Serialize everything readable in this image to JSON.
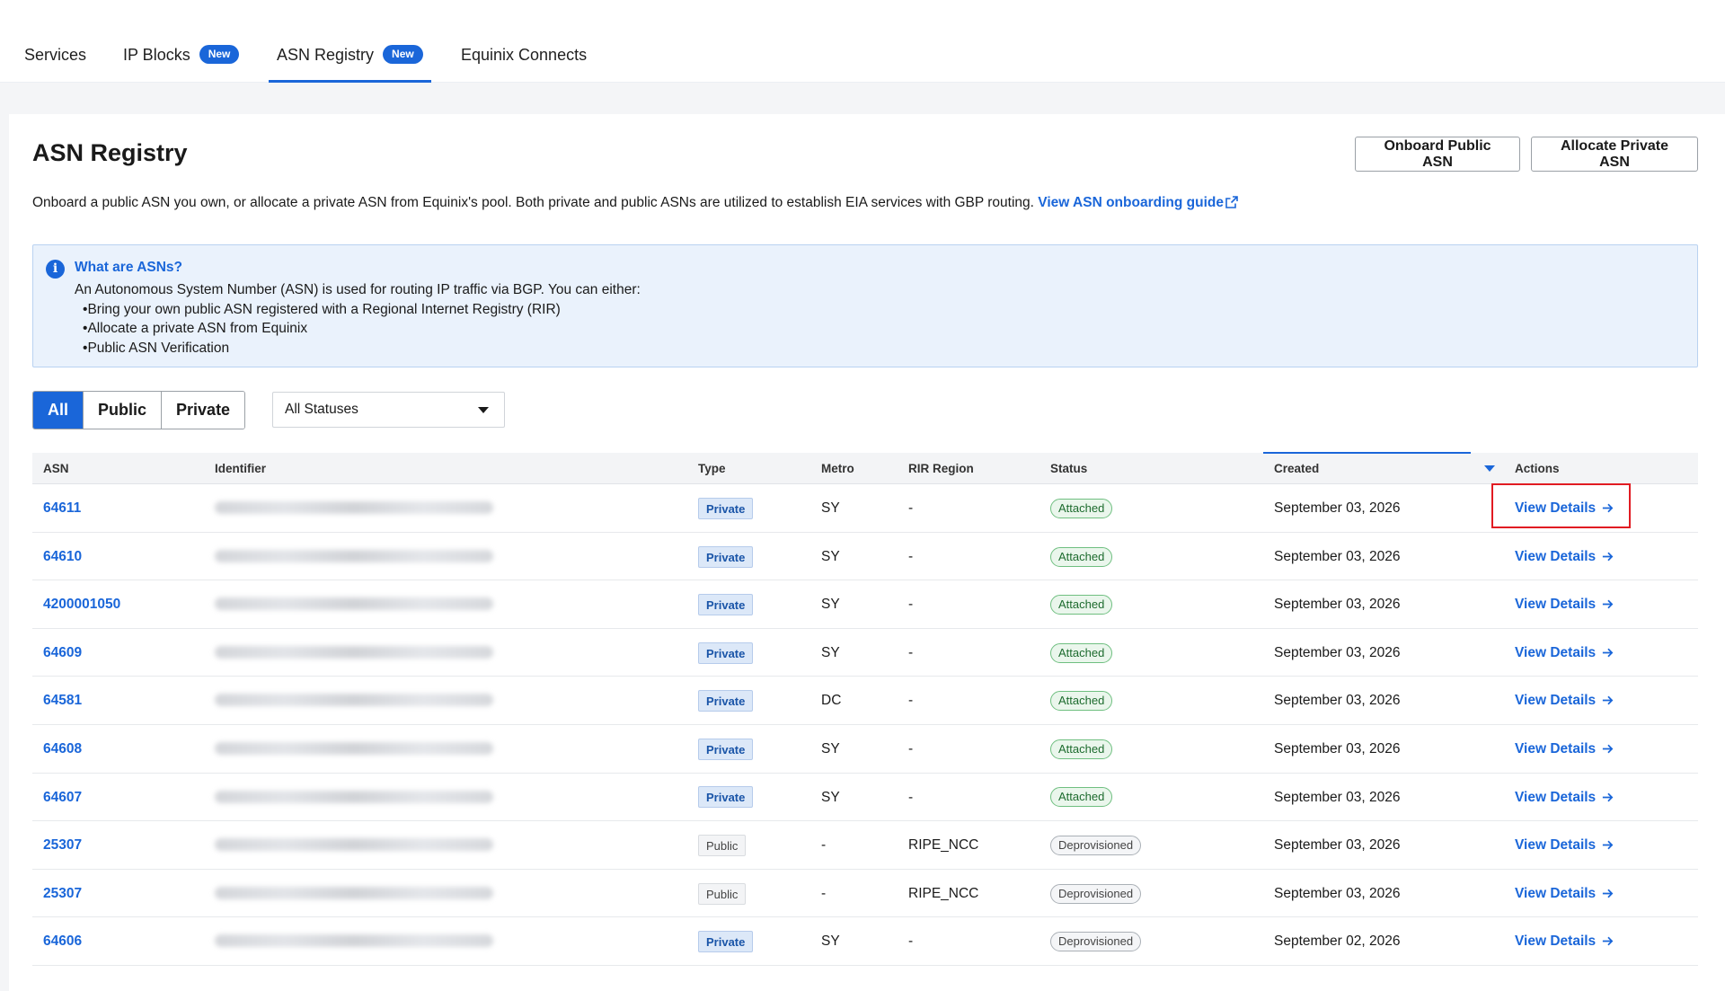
{
  "nav": {
    "tabs": [
      {
        "label": "Services",
        "badge": ""
      },
      {
        "label": "IP Blocks",
        "badge": "New"
      },
      {
        "label": "ASN Registry",
        "badge": "New"
      },
      {
        "label": "Equinix Connects",
        "badge": ""
      }
    ]
  },
  "header": {
    "title": "ASN Registry",
    "onboard_button": "Onboard Public ASN",
    "allocate_button": "Allocate Private ASN",
    "description": "Onboard a public ASN you own, or allocate a private ASN from Equinix's pool. Both private and public ASNs are utilized to establish EIA services with GBP routing.",
    "guide_link": "View ASN onboarding guide"
  },
  "info": {
    "title": "What are ASNs?",
    "text": "An Autonomous System Number (ASN) is used for routing IP traffic via BGP. You can either:",
    "bullets": [
      "Bring your own public ASN registered with a Regional Internet Registry (RIR)",
      "Allocate a private ASN from Equinix",
      "Public ASN Verification"
    ]
  },
  "filters": {
    "segments": [
      "All",
      "Public",
      "Private"
    ],
    "selected_segment": "All",
    "status_select": "All Statuses"
  },
  "table": {
    "columns": [
      "ASN",
      "Identifier",
      "Type",
      "Metro",
      "RIR Region",
      "Status",
      "Created",
      "Actions"
    ],
    "action_label": "View Details",
    "rows": [
      {
        "asn": "64611",
        "type": "Private",
        "metro": "SY",
        "rir": "-",
        "status": "Attached",
        "created": "September 03, 2026"
      },
      {
        "asn": "64610",
        "type": "Private",
        "metro": "SY",
        "rir": "-",
        "status": "Attached",
        "created": "September 03, 2026"
      },
      {
        "asn": "4200001050",
        "type": "Private",
        "metro": "SY",
        "rir": "-",
        "status": "Attached",
        "created": "September 03, 2026"
      },
      {
        "asn": "64609",
        "type": "Private",
        "metro": "SY",
        "rir": "-",
        "status": "Attached",
        "created": "September 03, 2026"
      },
      {
        "asn": "64581",
        "type": "Private",
        "metro": "DC",
        "rir": "-",
        "status": "Attached",
        "created": "September 03, 2026"
      },
      {
        "asn": "64608",
        "type": "Private",
        "metro": "SY",
        "rir": "-",
        "status": "Attached",
        "created": "September 03, 2026"
      },
      {
        "asn": "64607",
        "type": "Private",
        "metro": "SY",
        "rir": "-",
        "status": "Attached",
        "created": "September 03, 2026"
      },
      {
        "asn": "25307",
        "type": "Public",
        "metro": "-",
        "rir": "RIPE_NCC",
        "status": "Deprovisioned",
        "created": "September 03, 2026"
      },
      {
        "asn": "25307",
        "type": "Public",
        "metro": "-",
        "rir": "RIPE_NCC",
        "status": "Deprovisioned",
        "created": "September 03, 2026"
      },
      {
        "asn": "64606",
        "type": "Private",
        "metro": "SY",
        "rir": "-",
        "status": "Deprovisioned",
        "created": "September 02, 2026"
      }
    ]
  },
  "colors": {
    "accent": "#1a66d9",
    "highlight": "#e11b22"
  }
}
